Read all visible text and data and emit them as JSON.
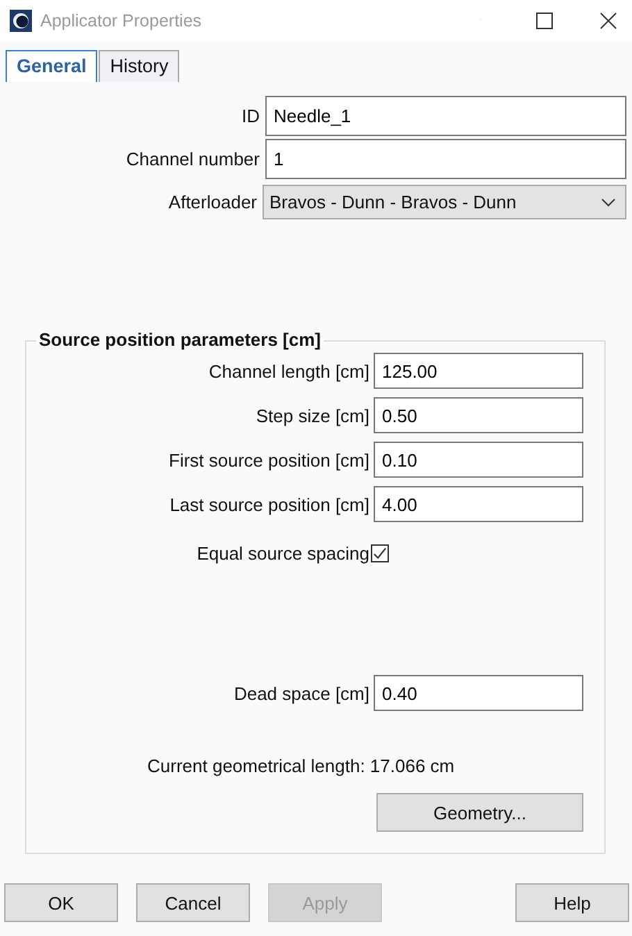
{
  "window": {
    "title": "Applicator Properties"
  },
  "tabs": [
    {
      "label": "General",
      "selected": true
    },
    {
      "label": "History",
      "selected": false
    }
  ],
  "fields": [
    {
      "label": "ID",
      "kind": "text",
      "value": "Needle_1"
    },
    {
      "label": "Channel number",
      "kind": "text",
      "value": "1"
    },
    {
      "label": "Afterloader",
      "kind": "dropdown",
      "value": "Bravos - Dunn - Bravos - Dunn"
    }
  ],
  "group": {
    "title": "Source position parameters [cm]",
    "rows": [
      {
        "label": "Channel length [cm]",
        "kind": "text",
        "value": "125.00"
      },
      {
        "label": "Step size [cm]",
        "kind": "text",
        "value": "0.50"
      },
      {
        "label": "First source position [cm]",
        "kind": "text",
        "value": "0.10"
      },
      {
        "label": "Last source position [cm]",
        "kind": "text",
        "value": "4.00"
      },
      {
        "label": "Equal source spacing",
        "kind": "checkbox",
        "checked": true
      }
    ],
    "dead_space": {
      "label": "Dead space [cm]",
      "value": "0.40"
    },
    "info": "Current geometrical length: 17.066 cm",
    "button": "Geometry..."
  },
  "buttons": [
    {
      "label": "OK",
      "disabled": false
    },
    {
      "label": "Cancel",
      "disabled": false
    },
    {
      "label": "Apply",
      "disabled": true
    },
    {
      "label": "Help",
      "disabled": false
    }
  ]
}
